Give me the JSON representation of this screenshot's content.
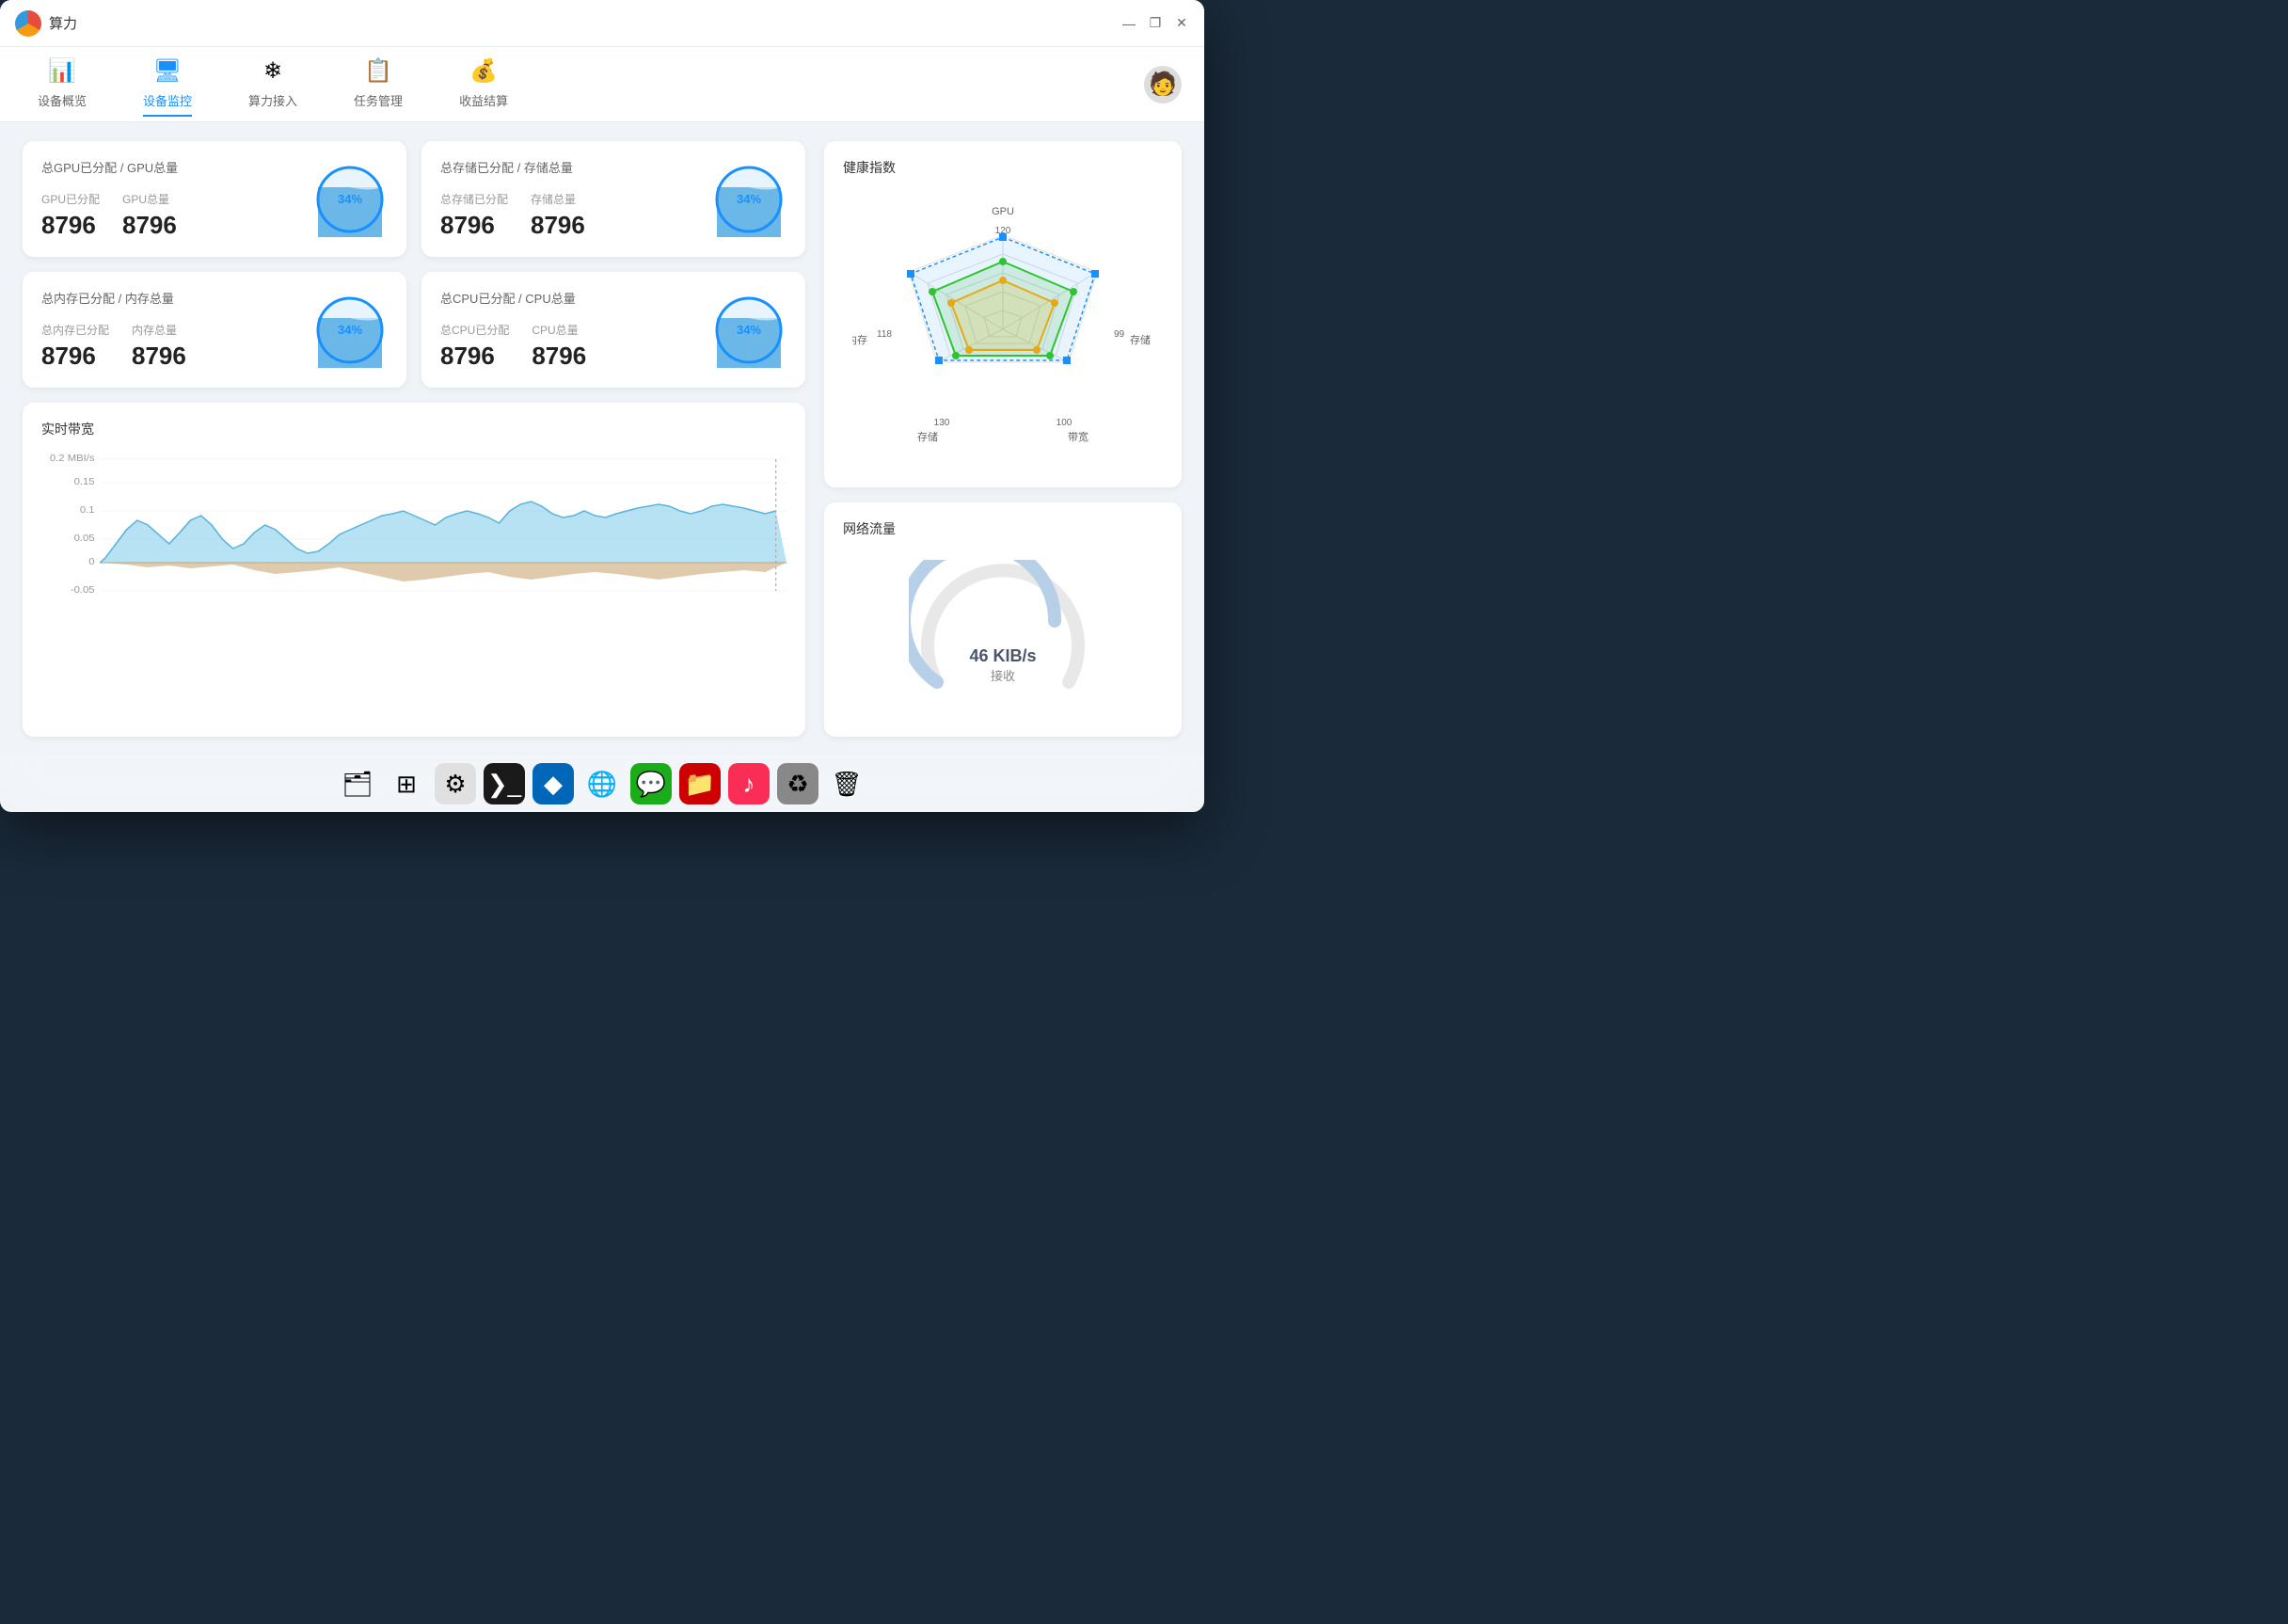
{
  "window": {
    "title": "算力",
    "controls": {
      "minimize": "—",
      "maximize": "❐",
      "close": "✕"
    }
  },
  "nav": {
    "items": [
      {
        "id": "overview",
        "label": "设备概览",
        "icon": "📊",
        "active": false
      },
      {
        "id": "monitor",
        "label": "设备监控",
        "icon": "🖥",
        "active": true
      },
      {
        "id": "compute",
        "label": "算力接入",
        "icon": "❄",
        "active": false
      },
      {
        "id": "task",
        "label": "任务管理",
        "icon": "📋",
        "active": false
      },
      {
        "id": "income",
        "label": "收益结算",
        "icon": "💰",
        "active": false
      }
    ]
  },
  "metrics": {
    "gpu": {
      "title": "总GPU已分配 / GPU总量",
      "allocated_label": "GPU已分配",
      "total_label": "GPU总量",
      "allocated_value": "8796",
      "total_value": "8796",
      "percent": 34
    },
    "storage": {
      "title": "总存储已分配 / 存储总量",
      "allocated_label": "总存储已分配",
      "total_label": "存储总量",
      "allocated_value": "8796",
      "total_value": "8796",
      "percent": 34
    },
    "memory": {
      "title": "总内存已分配 / 内存总量",
      "allocated_label": "总内存已分配",
      "total_label": "内存总量",
      "allocated_value": "8796",
      "total_value": "8796",
      "percent": 34
    },
    "cpu": {
      "title": "总CPU已分配 / CPU总量",
      "allocated_label": "总CPU已分配",
      "total_label": "CPU总量",
      "allocated_value": "8796",
      "total_value": "8796",
      "percent": 34
    }
  },
  "bandwidth": {
    "title": "实时带宽",
    "y_max": "0.2 MBI/s",
    "y_values": [
      "0.15",
      "0.1",
      "0.05",
      "0",
      "-0.05"
    ]
  },
  "health": {
    "title": "健康指数",
    "radar": {
      "labels": [
        "GPU",
        "存储",
        "带宽",
        "存储",
        "内存"
      ],
      "values": {
        "gpu": 120,
        "storage_right": 99,
        "bandwidth": 100,
        "storage_bottom": 130,
        "memory": 118
      }
    }
  },
  "network": {
    "title": "网络流量",
    "speed": "46 KIB/s",
    "label": "接收"
  },
  "dock": {
    "items": [
      {
        "id": "finder",
        "icon": "🗂",
        "label": "Finder"
      },
      {
        "id": "launchpad",
        "icon": "🔲",
        "label": "Launchpad"
      },
      {
        "id": "settings",
        "icon": "⚙️",
        "label": "Settings"
      },
      {
        "id": "terminal",
        "icon": "⬛",
        "label": "Terminal"
      },
      {
        "id": "vscode",
        "icon": "💙",
        "label": "VSCode"
      },
      {
        "id": "chrome",
        "icon": "🌐",
        "label": "Chrome"
      },
      {
        "id": "wechat",
        "icon": "💬",
        "label": "WeChat"
      },
      {
        "id": "filezilla",
        "icon": "📁",
        "label": "FileZilla"
      },
      {
        "id": "music",
        "icon": "🎵",
        "label": "Music"
      },
      {
        "id": "app9",
        "icon": "♻",
        "label": "App9"
      },
      {
        "id": "trash",
        "icon": "🗑",
        "label": "Trash"
      }
    ]
  }
}
